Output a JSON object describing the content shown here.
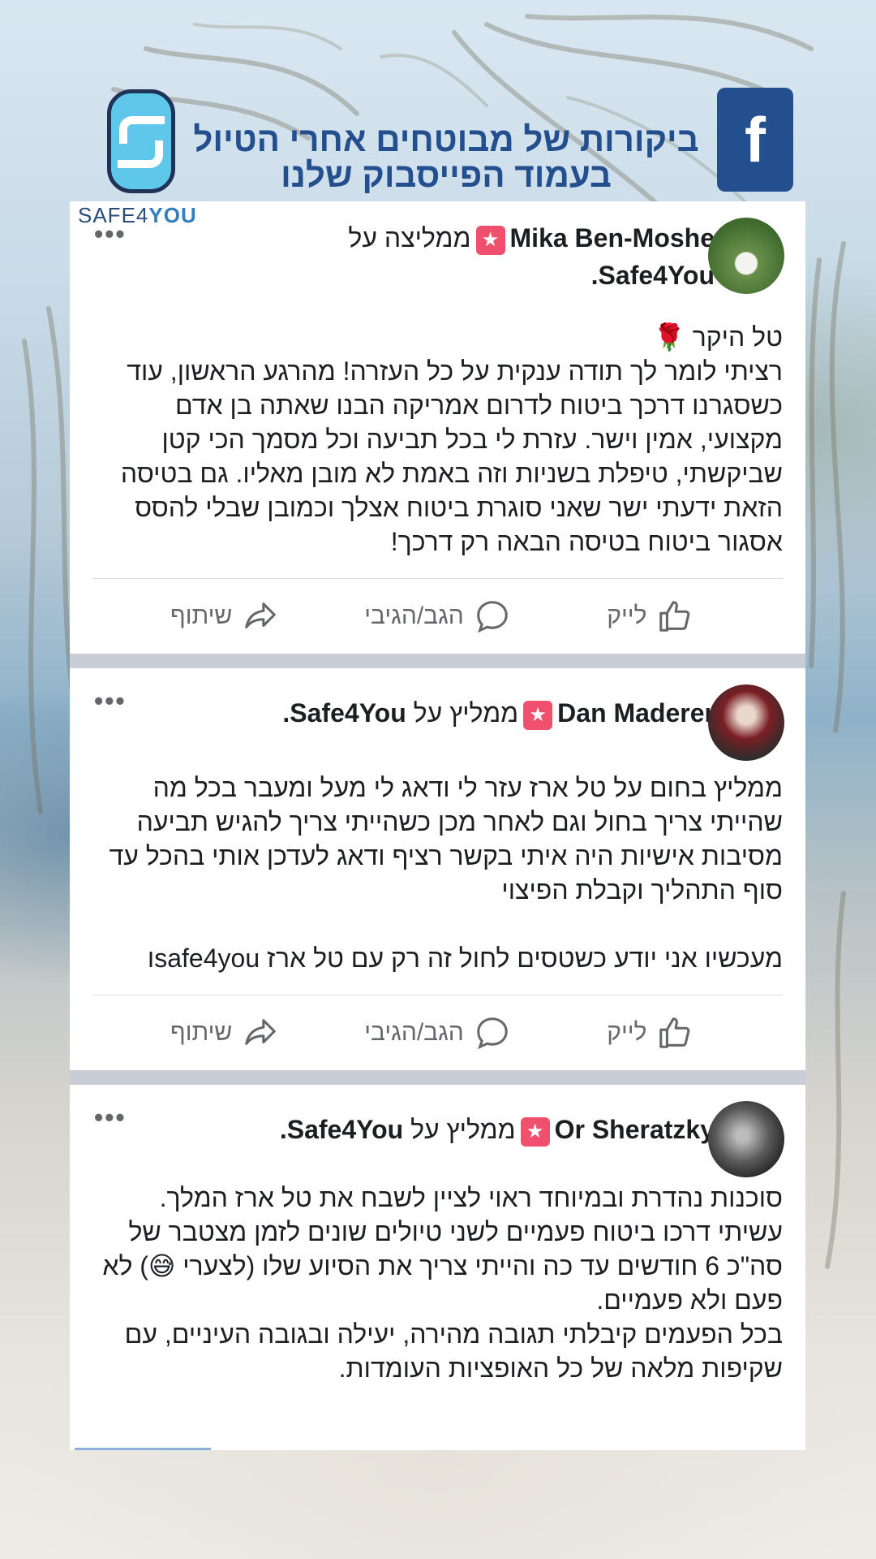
{
  "header": {
    "title_line1": "ביקורות של מבוטחים אחרי הטיול",
    "title_line2": "בעמוד הפייסבוק שלנו",
    "fb_icon": "facebook-icon",
    "brand_prefix": "SAFE4",
    "brand_suffix": "YOU"
  },
  "posts": [
    {
      "author": "Mika Ben-Moshe",
      "recommend_text": "ממליצה על",
      "page": "Safe4You.",
      "more": "•••",
      "body": [
        "טל היקר 🌹",
        "רציתי לומר לך תודה ענקית על כל העזרה! מהרגע הראשון, עוד כשסגרנו דרכך ביטוח לדרום אמריקה הבנו שאתה בן אדם מקצועי, אמין וישר. עזרת לי בכל תביעה וכל מסמך הכי קטן שביקשתי, טיפלת בשניות וזה באמת לא מובן מאליו. גם בטיסה הזאת ידעתי ישר שאני סוגרת ביטוח אצלך וכמובן שבלי להסס אסגור ביטוח בטיסה הבאה רק דרכך!"
      ]
    },
    {
      "author": "Dan Maderer",
      "recommend_text": "ממליץ על",
      "page": "Safe4You.",
      "more": "•••",
      "body": [
        "ממליץ בחום על טל ארז עזר לי ודאג לי מעל ומעבר בכל מה שהייתי צריך בחול וגם לאחר מכן כשהייתי צריך להגיש תביעה מסיבות אישיות היה איתי בקשר רציף ודאג לעדכן אותי בהכל עד סוף התהליך וקבלת הפיצוי",
        "",
        "מעכשיו אני יודע כשטסים לחול זה רק עם טל ארז safe4youו"
      ]
    },
    {
      "author": "Or Sheratzky",
      "recommend_text": "ממליץ על",
      "page": "Safe4You.",
      "more": "•••",
      "body": [
        "סוכנות נהדרת ובמיוחד ראוי לציין לשבח את טל ארז המלך. עשיתי דרכו ביטוח פעמיים לשני טיולים שונים לזמן מצטבר של סה\"כ 6 חודשים עד כה והייתי צריך את הסיוע שלו (לצערי 😅) לא פעם ולא פעמיים.",
        "בכל הפעמים קיבלתי תגובה מהירה, יעילה ובגובה העיניים, עם שקיפות מלאה של כל האופציות העומדות."
      ]
    }
  ],
  "actions": {
    "like": "לייק",
    "comment": "הגב/הגיבי",
    "share": "שיתוף"
  },
  "icons": {
    "like": "thumbs-up-icon",
    "comment": "comment-bubble-icon",
    "share": "share-arrow-icon",
    "recommend": "recommend-star-icon"
  },
  "colors": {
    "brand_blue": "#234f8f",
    "logo_cyan": "#5fc7ea",
    "recommend_badge": "#f0506e",
    "text": "#1c1e21",
    "muted": "#65676b"
  }
}
